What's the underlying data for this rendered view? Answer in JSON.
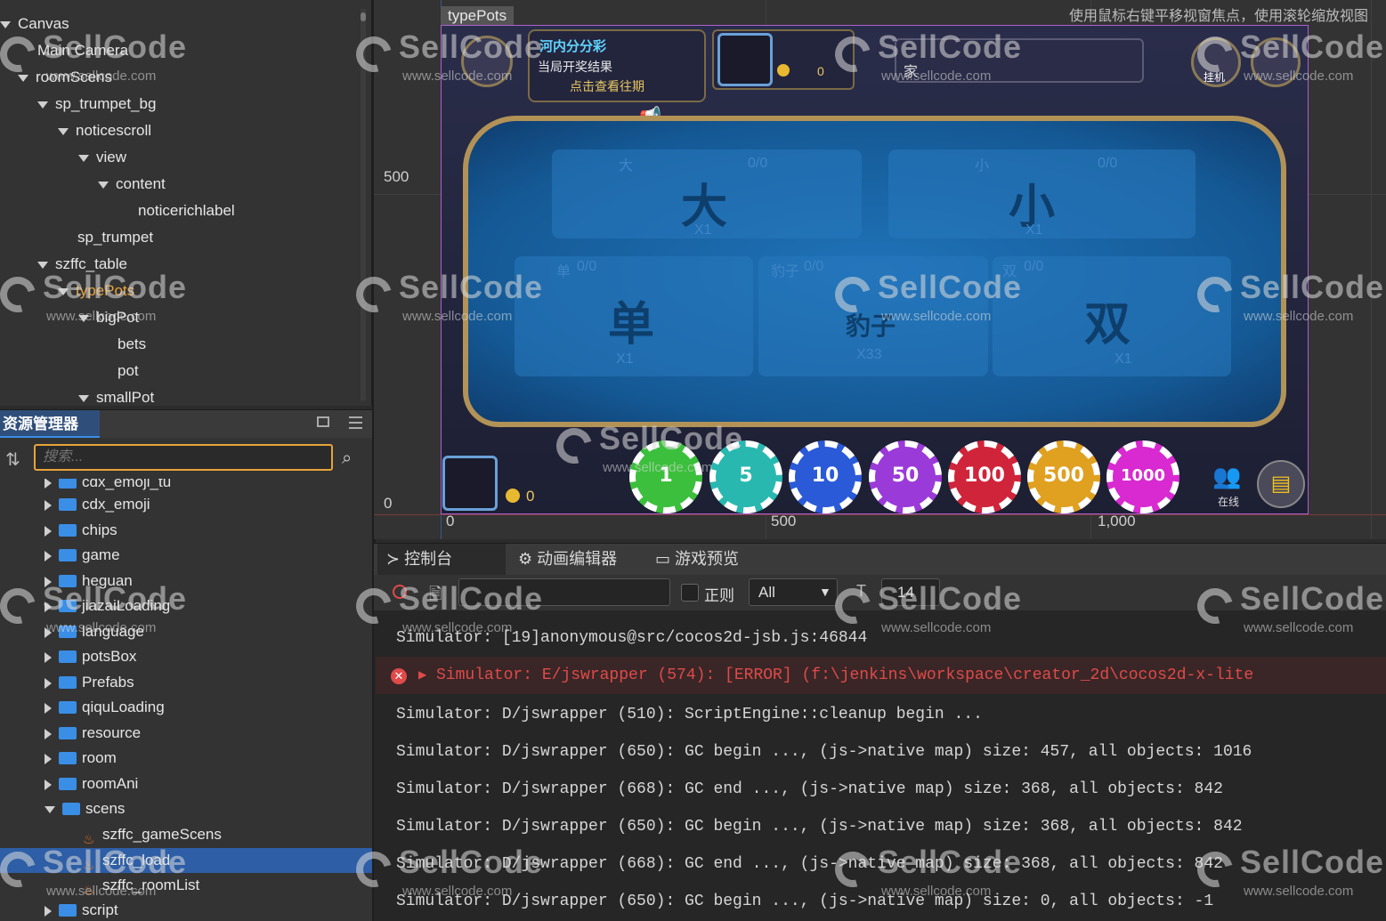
{
  "hierarchy": {
    "items": [
      {
        "label": "Canvas"
      },
      {
        "label": "Main Camera"
      },
      {
        "label": "roomScens"
      },
      {
        "label": "sp_trumpet_bg"
      },
      {
        "label": "noticescroll"
      },
      {
        "label": "view"
      },
      {
        "label": "content"
      },
      {
        "label": "noticerichlabel"
      },
      {
        "label": "sp_trumpet"
      },
      {
        "label": "szffc_table"
      },
      {
        "label": "typePots"
      },
      {
        "label": "bigPot"
      },
      {
        "label": "bets"
      },
      {
        "label": "pot"
      },
      {
        "label": "smallPot"
      }
    ]
  },
  "assets": {
    "tab_label": "资源管理器",
    "search_placeholder": "搜索...",
    "items": [
      {
        "label": "cdx_emoji_tu"
      },
      {
        "label": "cdx_emoji"
      },
      {
        "label": "chips"
      },
      {
        "label": "game"
      },
      {
        "label": "heguan"
      },
      {
        "label": "jiazaiLoading"
      },
      {
        "label": "language"
      },
      {
        "label": "potsBox"
      },
      {
        "label": "Prefabs"
      },
      {
        "label": "qiquLoading"
      },
      {
        "label": "resource"
      },
      {
        "label": "room"
      },
      {
        "label": "roomAni"
      },
      {
        "label": "scens"
      },
      {
        "label": "szffc_gameScens"
      },
      {
        "label": "szffc_load"
      },
      {
        "label": "szffc_roomList"
      },
      {
        "label": "script"
      }
    ]
  },
  "scene": {
    "hint": "使用鼠标右键平移视窗焦点，使用滚轮缩放视图",
    "node_label": "typePots",
    "axis_y": [
      "500",
      "0"
    ],
    "axis_x": [
      "0",
      "500",
      "1,000"
    ]
  },
  "game": {
    "lottery_title": "河内分分彩",
    "lottery_sub": "当局开奖结果",
    "lottery_link": "点击查看往期",
    "top_balance": "0",
    "top_name": "家",
    "btn_hangup": "挂机",
    "zones": [
      {
        "label": "大",
        "count": "0/0",
        "big": "大",
        "odds": "X1"
      },
      {
        "label": "小",
        "count": "0/0",
        "big": "小",
        "odds": "X1"
      },
      {
        "label": "单",
        "count": "0/0",
        "big": "单",
        "odds": "X1"
      },
      {
        "label": "豹子",
        "count": "0/0",
        "big": "豹子",
        "odds": "X33"
      },
      {
        "label": "双",
        "count": "0/0",
        "big": "双",
        "odds": "X1"
      }
    ],
    "bottom_balance": "0",
    "chips": [
      "1",
      "5",
      "10",
      "50",
      "100",
      "500",
      "1000"
    ],
    "online_label": "在线"
  },
  "console": {
    "tabs": [
      "控制台",
      "动画编辑器",
      "游戏预览"
    ],
    "regex_label": "正则",
    "filter_value": "All",
    "font_size": "14",
    "lines": [
      {
        "text": "Simulator: [19]anonymous@src/cocos2d-jsb.js:46844"
      },
      {
        "text": "Simulator: E/jswrapper (574): [ERROR] (f:\\jenkins\\workspace\\creator_2d\\cocos2d-x-lite"
      },
      {
        "text": "Simulator: D/jswrapper (510): ScriptEngine::cleanup begin ..."
      },
      {
        "text": "Simulator: D/jswrapper (650): GC begin ..., (js->native map) size: 457, all objects: 1016"
      },
      {
        "text": "Simulator: D/jswrapper (668): GC end ..., (js->native map) size: 368, all objects: 842"
      },
      {
        "text": "Simulator: D/jswrapper (650): GC begin ..., (js->native map) size: 368, all objects: 842"
      },
      {
        "text": "Simulator: D/jswrapper (668): GC end ..., (js->native map) size: 368, all objects: 842"
      },
      {
        "text": "Simulator: D/jswrapper (650): GC begin ..., (js->native map) size: 0, all objects: -1"
      }
    ]
  },
  "watermark": {
    "brand": "SellCode",
    "url": "www.sellcode.com"
  },
  "colors": {
    "accent": "#3a8ee6",
    "selected": "#e8a33a",
    "error": "#e04a4a",
    "table": "#1f72b8",
    "trim": "#b29257"
  }
}
